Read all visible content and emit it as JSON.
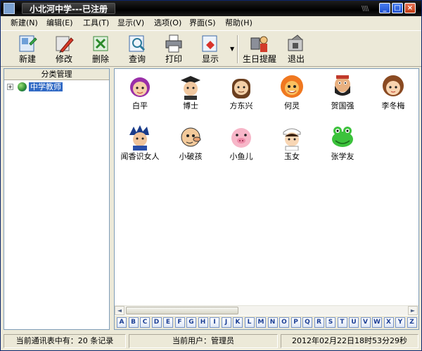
{
  "window": {
    "title": "小北河中学---已注册"
  },
  "menu": [
    "新建(N)",
    "编辑(E)",
    "工具(T)",
    "显示(V)",
    "选项(O)",
    "界面(S)",
    "帮助(H)"
  ],
  "toolbar": {
    "new": "新建",
    "edit": "修改",
    "delete": "删除",
    "query": "查询",
    "print": "打印",
    "display": "显示",
    "birthday": "生日提醒",
    "exit": "退出"
  },
  "left_panel": {
    "header": "分类管理",
    "tree_root": "中学教师"
  },
  "contacts": [
    {
      "name": "白平",
      "icon": "purple-hair-girl-icon"
    },
    {
      "name": "博士",
      "icon": "graduate-icon"
    },
    {
      "name": "方东兴",
      "icon": "long-hair-man-icon"
    },
    {
      "name": "何灵",
      "icon": "orange-character-icon"
    },
    {
      "name": "贺国强",
      "icon": "bearded-man-icon"
    },
    {
      "name": "李冬梅",
      "icon": "brown-hair-girl-icon"
    },
    {
      "name": "闻香识女人",
      "icon": "spiky-hair-man-icon"
    },
    {
      "name": "小破孩",
      "icon": "bald-kid-icon"
    },
    {
      "name": "小鱼儿",
      "icon": "pig-icon"
    },
    {
      "name": "玉女",
      "icon": "nurse-icon"
    },
    {
      "name": "张学友",
      "icon": "green-frog-icon"
    }
  ],
  "alphabet": [
    "A",
    "B",
    "C",
    "D",
    "E",
    "F",
    "G",
    "H",
    "I",
    "J",
    "K",
    "L",
    "M",
    "N",
    "O",
    "P",
    "Q",
    "R",
    "S",
    "T",
    "U",
    "V",
    "W",
    "X",
    "Y",
    "Z"
  ],
  "status": {
    "records": "当前通讯表中有：20 条记录",
    "user": "当前用户：管理员",
    "datetime": "2012年02月22日18时53分29秒"
  }
}
